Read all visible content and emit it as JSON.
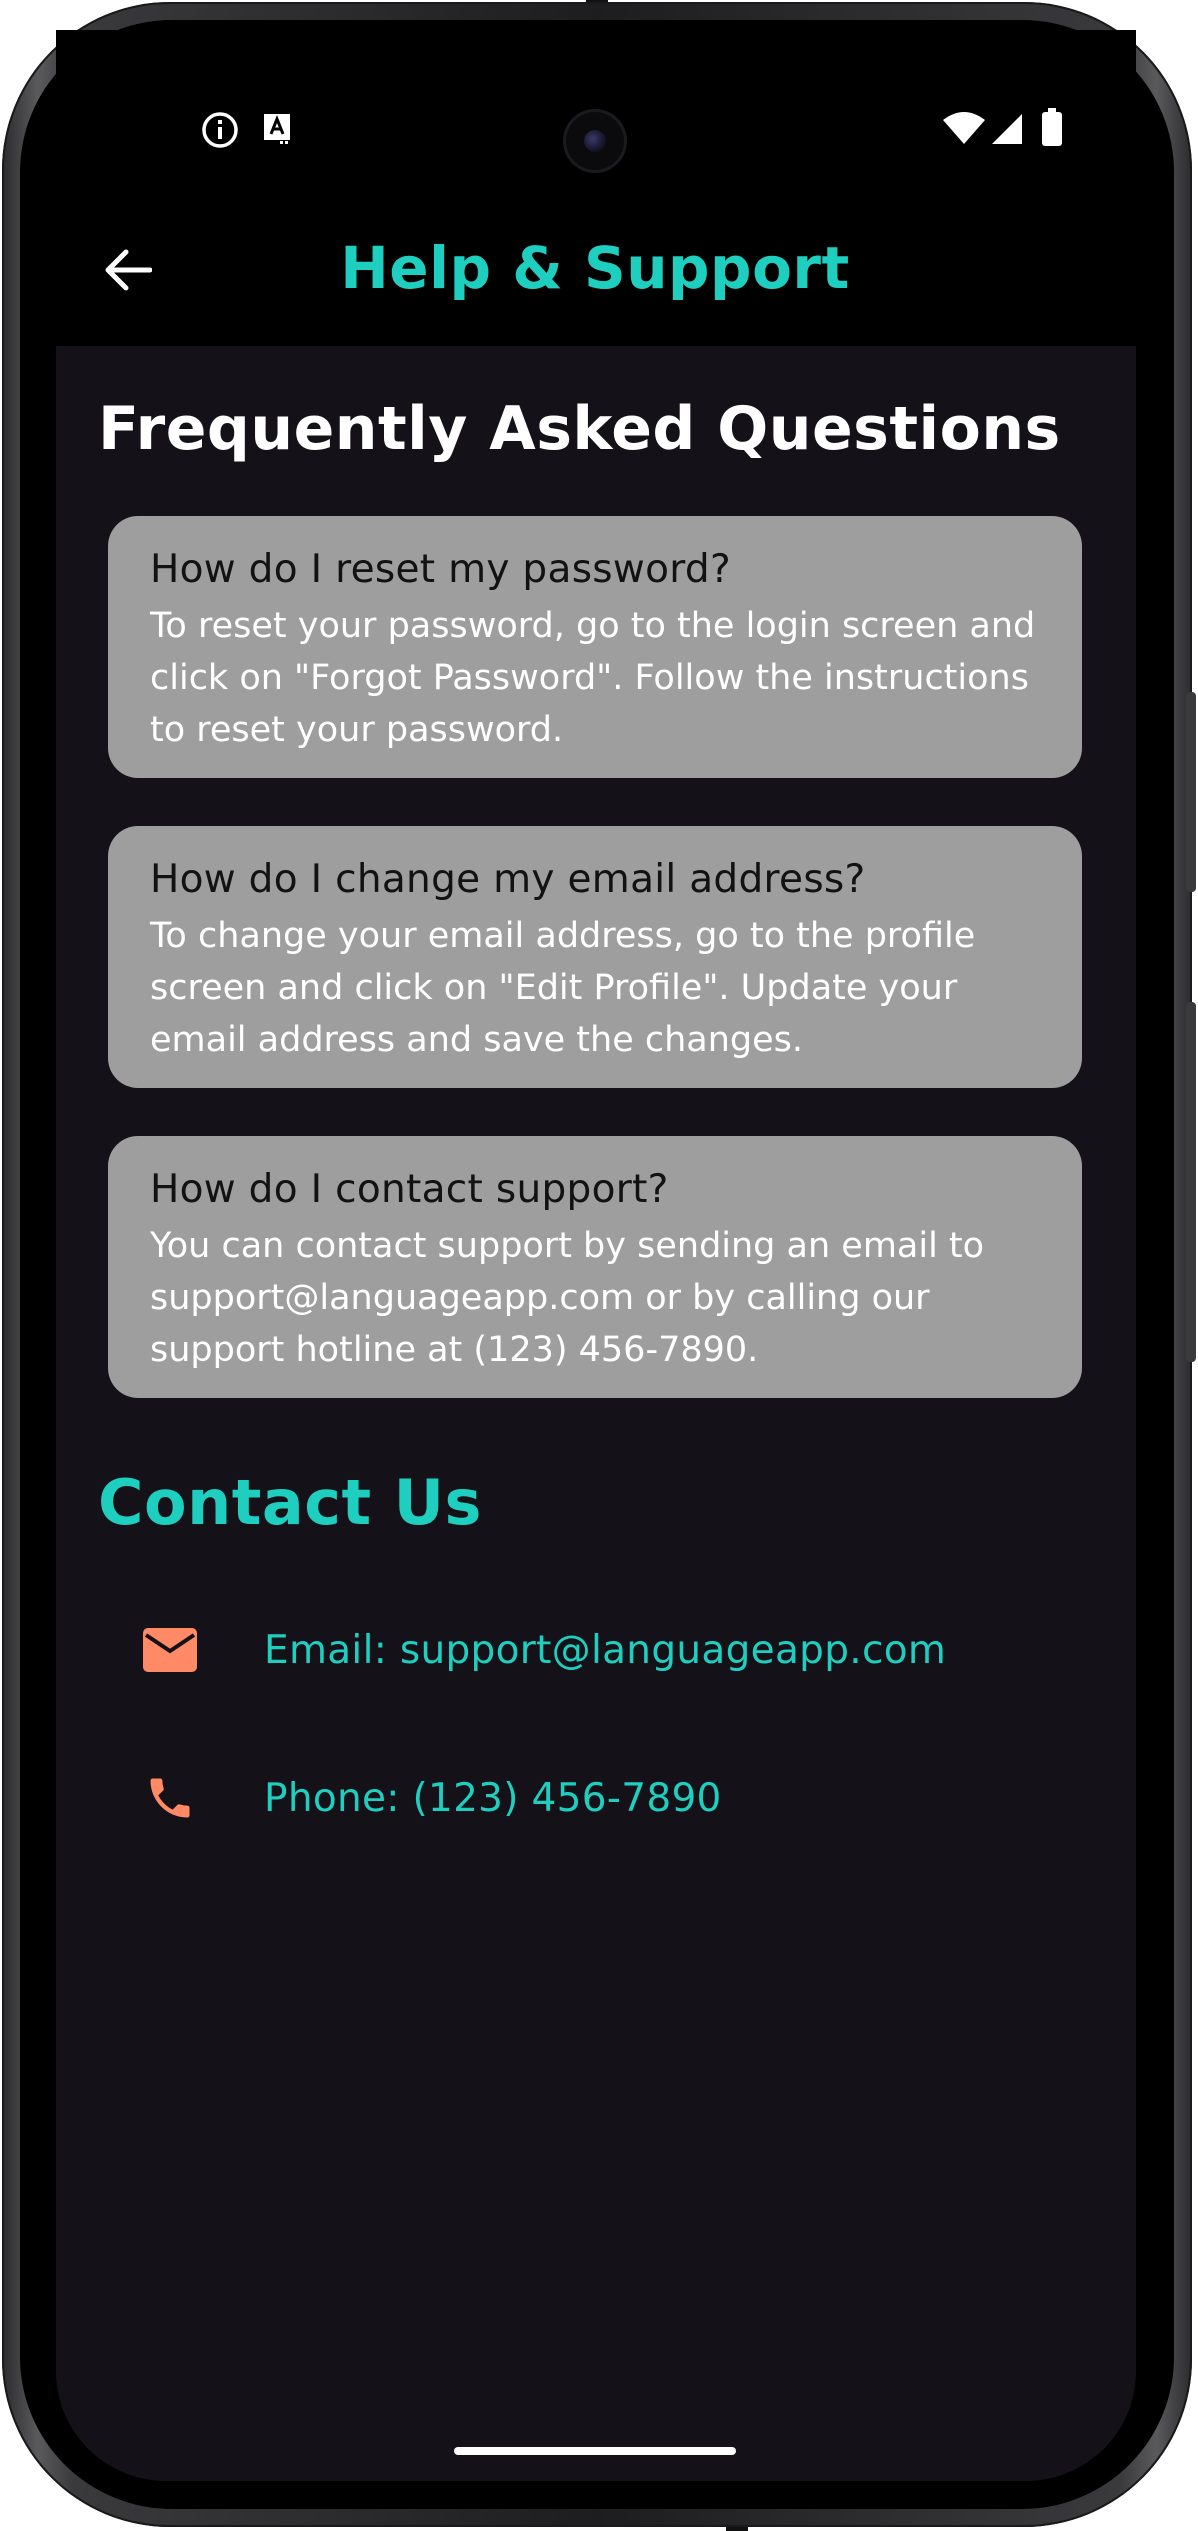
{
  "status_bar": {
    "left_icons": [
      "info-icon",
      "text-format-icon"
    ],
    "right_icons": [
      "wifi-icon",
      "cellular-signal-icon",
      "battery-icon"
    ]
  },
  "app_bar": {
    "back_icon": "arrow-back-icon",
    "title": "Help & Support",
    "title_color": "#1ecfc0"
  },
  "faq": {
    "heading": "Frequently Asked Questions",
    "items": [
      {
        "question": "How do I reset my password?",
        "answer": "To reset your password, go to the login screen and click on \"Forgot Password\". Follow the instructions to reset your password."
      },
      {
        "question": "How do I change my email address?",
        "answer": "To change your email address, go to the profile screen and click on \"Edit Profile\". Update your email address and save the changes."
      },
      {
        "question": "How do I contact support?",
        "answer": "You can contact support by sending an email to support@languageapp.com or by calling our support hotline at (123) 456-7890."
      }
    ]
  },
  "contact": {
    "heading": "Contact Us",
    "icon_color": "#ff8a65",
    "items": [
      {
        "icon": "email-icon",
        "label": "Email: support@languageapp.com"
      },
      {
        "icon": "phone-icon",
        "label": "Phone: (123) 456-7890"
      }
    ]
  }
}
